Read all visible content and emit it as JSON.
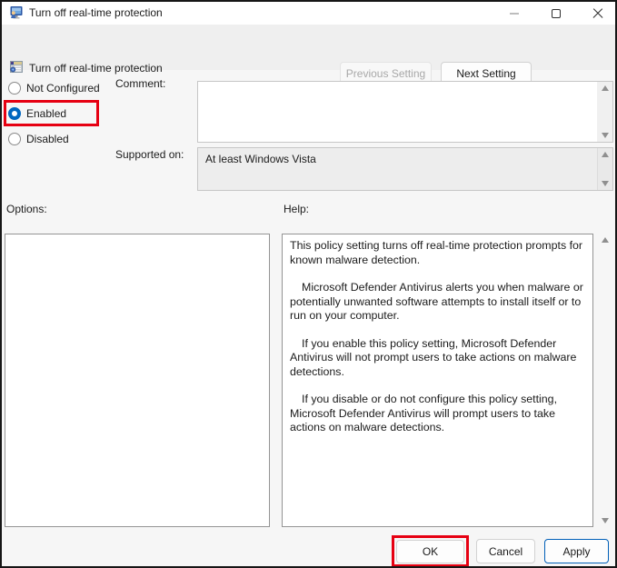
{
  "window": {
    "title": "Turn off real-time protection",
    "controls": [
      {
        "name": "minimize",
        "enabled": false
      },
      {
        "name": "maximize",
        "enabled": true
      },
      {
        "name": "close",
        "enabled": true
      }
    ]
  },
  "header": {
    "title": "Turn off real-time protection",
    "previous_button": "Previous Setting",
    "next_button": "Next Setting"
  },
  "settings": {
    "radios": [
      {
        "label": "Not Configured",
        "selected": false
      },
      {
        "label": "Enabled",
        "selected": true,
        "highlighted": true
      },
      {
        "label": "Disabled",
        "selected": false
      }
    ],
    "comment_label": "Comment:",
    "comment_value": "",
    "supported_label": "Supported on:",
    "supported_value": "At least Windows Vista"
  },
  "options": {
    "label": "Options:"
  },
  "help": {
    "label": "Help:",
    "paragraphs": [
      "This policy setting turns off real-time protection prompts for known malware detection.",
      "Microsoft Defender Antivirus alerts you when malware or potentially unwanted software attempts to install itself or to run on your computer.",
      "If you enable this policy setting, Microsoft Defender Antivirus will not prompt users to take actions on malware detections.",
      "If you disable or do not configure this policy setting, Microsoft Defender Antivirus will prompt users to take actions on malware detections."
    ]
  },
  "footer": {
    "ok_label": "OK",
    "cancel_label": "Cancel",
    "apply_label": "Apply"
  },
  "colors": {
    "accent": "#005fb8",
    "radio_checked": "#0067c0",
    "highlight_red": "#e60012"
  }
}
